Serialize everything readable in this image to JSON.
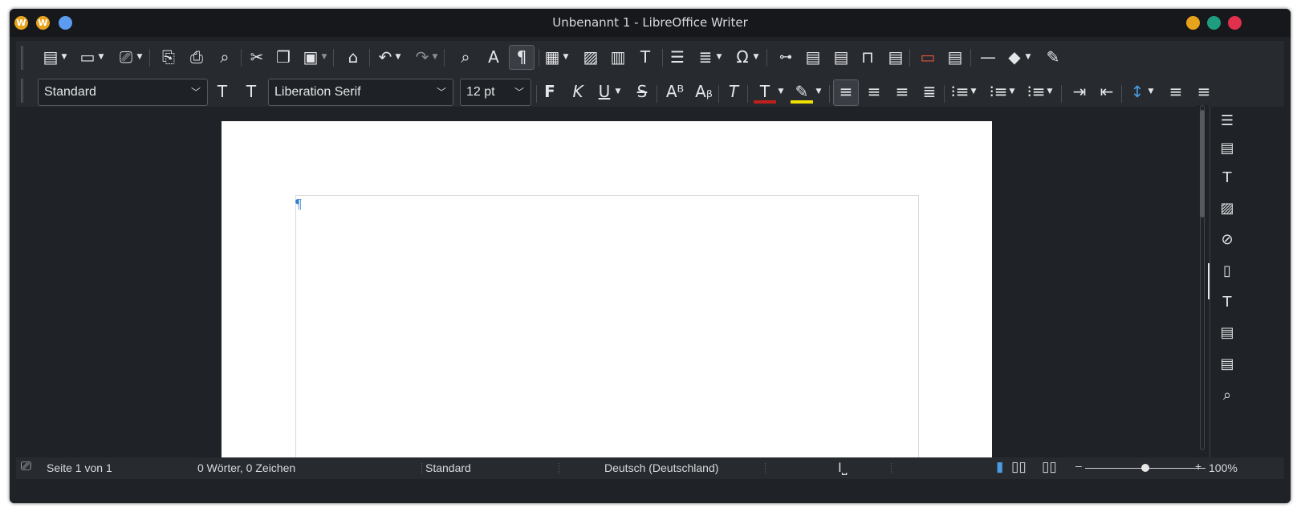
{
  "window": {
    "title": "Unbenannt 1 - LibreOffice Writer",
    "left_buttons": [
      "W",
      "W"
    ],
    "traffic_colors": {
      "minimize": "#e8a31c",
      "maximize": "#1e9e7e",
      "close": "#e0304e",
      "blue": "#5b9cf0"
    }
  },
  "toolbar_standard": {
    "items": [
      {
        "name": "new-document-icon",
        "glyph": "▤"
      },
      {
        "name": "open-icon",
        "glyph": "▭"
      },
      {
        "name": "save-icon",
        "glyph": "💾"
      },
      {
        "name": "export-pdf-icon",
        "glyph": "⎘"
      },
      {
        "name": "print-icon",
        "glyph": "⎙"
      },
      {
        "name": "print-preview-icon",
        "glyph": "⌕"
      },
      {
        "name": "cut-icon",
        "glyph": "✂"
      },
      {
        "name": "copy-icon",
        "glyph": "❐"
      },
      {
        "name": "paste-icon",
        "glyph": "▣"
      },
      {
        "name": "clone-formatting-icon",
        "glyph": "⌂"
      },
      {
        "name": "undo-icon",
        "glyph": "↶"
      },
      {
        "name": "redo-icon",
        "glyph": "↷"
      },
      {
        "name": "find-replace-icon",
        "glyph": "⌕"
      },
      {
        "name": "spelling-icon",
        "glyph": "A"
      },
      {
        "name": "formatting-marks-icon",
        "glyph": "¶"
      },
      {
        "name": "insert-table-icon",
        "glyph": "▦"
      },
      {
        "name": "insert-image-icon",
        "glyph": "▨"
      },
      {
        "name": "insert-chart-icon",
        "glyph": "▥"
      },
      {
        "name": "insert-textbox-icon",
        "glyph": "T"
      },
      {
        "name": "insert-page-break-icon",
        "glyph": "☰"
      },
      {
        "name": "insert-field-icon",
        "glyph": "≣"
      },
      {
        "name": "special-character-icon",
        "glyph": "Ω"
      },
      {
        "name": "hyperlink-icon",
        "glyph": "⊶"
      },
      {
        "name": "footnote-icon",
        "glyph": "▤"
      },
      {
        "name": "endnote-icon",
        "glyph": "▤"
      },
      {
        "name": "bookmark-icon",
        "glyph": "⊓"
      },
      {
        "name": "cross-reference-icon",
        "glyph": "▤"
      },
      {
        "name": "comment-icon",
        "glyph": "▭"
      },
      {
        "name": "track-changes-icon",
        "glyph": "▤"
      },
      {
        "name": "insert-line-icon",
        "glyph": "—"
      },
      {
        "name": "basic-shapes-icon",
        "glyph": "◆"
      },
      {
        "name": "draw-icon",
        "glyph": "✎"
      }
    ]
  },
  "toolbar_formatting": {
    "paragraph_style": "Standard",
    "font_name": "Liberation Serif",
    "font_size": "12 pt",
    "bold_label": "F",
    "italic_label": "K",
    "underline_label": "U",
    "strike_label": "S",
    "font_color": "#c0201c",
    "highlight_color": "#f0e000"
  },
  "document": {
    "paragraph_mark": "¶"
  },
  "statusbar": {
    "page": "Seite 1 von 1",
    "words": "0 Wörter, 0 Zeichen",
    "page_style": "Standard",
    "language": "Deutsch (Deutschland)",
    "zoom_minus": "–",
    "zoom_plus": "+",
    "zoom_level": "100%",
    "zoom_fraction": 0.5
  }
}
